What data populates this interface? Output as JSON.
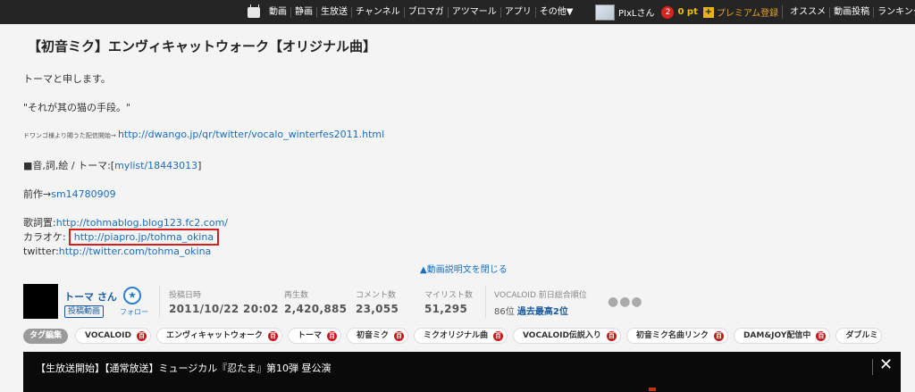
{
  "nav": {
    "items": [
      "動画",
      "静画",
      "生放送",
      "チャンネル",
      "ブロマガ",
      "アツマール",
      "アプリ",
      "その他▼"
    ]
  },
  "account": {
    "username": "PIxLさん",
    "notification_count": "2",
    "points": "0 pt",
    "premium_label": "プレミアム登録",
    "links": [
      "オススメ",
      "動画投稿",
      "ランキング"
    ]
  },
  "video": {
    "title": "【初音ミク】エンヴィキャットウォーク【オリジナル曲】",
    "description": {
      "line1": "トーマと申します。",
      "line2": "\"それが其の猫の手段。\"",
      "line3_prefix": "ドワンゴ様より賜うた配信開始→ ",
      "line3_link": "http://dwango.jp/qr/twitter/vocalo_winterfes2011.html",
      "line4_prefix": "■音,詞,絵 / トーマ:[",
      "line4_link": "mylist/18443013",
      "line4_suffix": "]",
      "line5_prefix": "前作→",
      "line5_link": "sm14780909",
      "lyrics_prefix": "歌詞置:",
      "lyrics_link": "http://tohmablog.blog123.fc2.com/",
      "karaoke_prefix": "カラオケ:",
      "karaoke_link": "http://piapro.jp/tohma_okina",
      "twitter_prefix": "twitter:",
      "twitter_link": "http://twitter.com/tohma_okina"
    },
    "close_description": "▲動画説明文を閉じる"
  },
  "uploader": {
    "name": "トーマ さん",
    "badge": "投稿動画",
    "follow_label": "フォロー"
  },
  "stats": {
    "posted_label": "投稿日時",
    "posted_value": "2011/10/22 20:02",
    "views_label": "再生数",
    "views_value": "2,420,885",
    "comments_label": "コメント数",
    "comments_value": "23,055",
    "mylist_label": "マイリスト数",
    "mylist_value": "51,295",
    "ranking_label": "VOCALOID 前日総合順位",
    "ranking_value": "86位",
    "ranking_best": "過去最高2位"
  },
  "tags": {
    "edit_label": "タグ編集",
    "items": [
      "VOCALOID",
      "エンヴィキャットウォーク",
      "トーマ",
      "初音ミク",
      "ミクオリジナル曲",
      "VOCALOID伝説入り",
      "初音ミク名曲リンク",
      "DAM&JOY配信中",
      "ダブルミ"
    ],
    "dict_glyph": "百"
  },
  "banner": {
    "text": "【生放送開始】【通常放送】ミュージカル『忍たま』第10弾 昼公演",
    "close": "✕"
  }
}
